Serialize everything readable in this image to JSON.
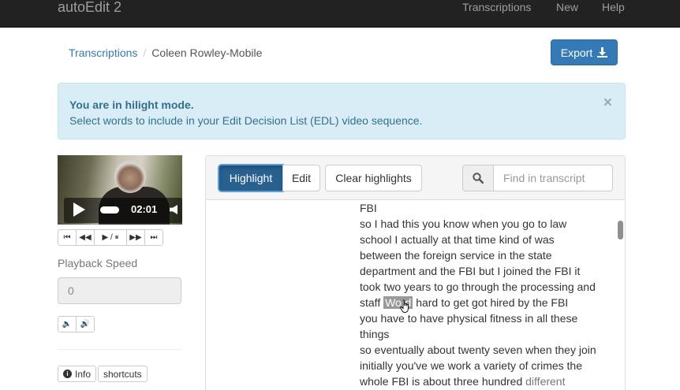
{
  "navbar": {
    "brand": "autoEdit 2",
    "links": [
      "Transcriptions",
      "New",
      "Help"
    ]
  },
  "breadcrumb": {
    "parent": "Transcriptions",
    "current": "Coleen Rowley-Mobile"
  },
  "export_button": {
    "label": "Export"
  },
  "alert": {
    "title": "You are in hilight mode.",
    "message": "Select words to include in your Edit Decision List (EDL) video sequence.",
    "close": "×"
  },
  "player": {
    "time": "02:01",
    "transport": [
      "⏮",
      "◀◀",
      "▶ / ⏸",
      "▶▶",
      "⏭"
    ]
  },
  "playback_speed": {
    "label": "Playback Speed",
    "placeholder": "0"
  },
  "volume_buttons": [
    "🔈",
    "🔊"
  ],
  "bottom_buttons": {
    "info": "Info",
    "shortcuts": "shortcuts"
  },
  "toolbar": {
    "highlight": "Highlight",
    "edit": "Edit",
    "clear": "Clear highlights",
    "search_placeholder": "Find in transcript"
  },
  "transcript": {
    "lines": [
      "FBI",
      "so I had this you know when you go to law",
      "school I actually at that time kind of was",
      "between the foreign service in the state",
      "department and the FBI but I joined the FBI it",
      "took two years to go through the processing and",
      "hard to get got hired by the FBI",
      "you have to have physical fitness in all these",
      "things",
      "so eventually about twenty seven when they join",
      "initially you've we work a variety of crimes the",
      "whole FBI is about three hundred"
    ],
    "staff_prefix": "staff",
    "highlighted_word": "Word",
    "grey_word": "different"
  },
  "colors": {
    "primary": "#337ab7",
    "navbar": "#222222",
    "alert_bg": "#d9edf7",
    "highlight": "#999999"
  }
}
